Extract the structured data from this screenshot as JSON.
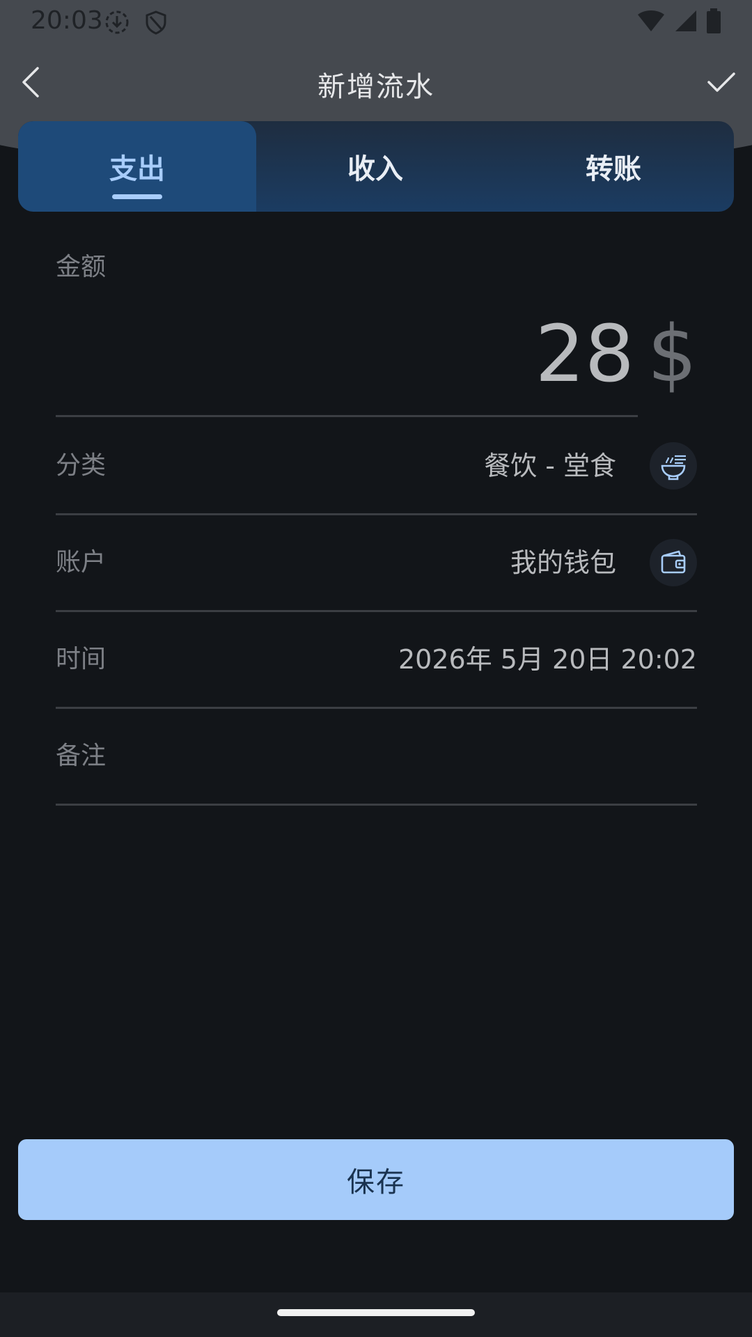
{
  "status_bar": {
    "time": "20:03",
    "icons": [
      "download-circle-icon",
      "shield-icon",
      "wifi-icon",
      "cellular-signal-icon",
      "battery-icon"
    ]
  },
  "app_bar": {
    "title": "新增流水",
    "back_icon": "chevron-left-icon",
    "confirm_icon": "checkmark-icon"
  },
  "tabs": [
    {
      "label": "支出",
      "active": true
    },
    {
      "label": "收入",
      "active": false
    },
    {
      "label": "转账",
      "active": false
    }
  ],
  "form": {
    "amount": {
      "label": "金额",
      "value": "28",
      "currency": "$"
    },
    "category": {
      "label": "分类",
      "value": "餐饮 - 堂食",
      "icon": "noodle-bowl-icon"
    },
    "account": {
      "label": "账户",
      "value": "我的钱包",
      "icon": "wallet-icon"
    },
    "time": {
      "label": "时间",
      "value": "2026年 5月 20日 20:02"
    },
    "note": {
      "label": "备注",
      "value": ""
    }
  },
  "save_button": {
    "label": "保存"
  },
  "colors": {
    "background": "#121519",
    "header": "#45494f",
    "tab_active": "#1e4a79",
    "accent": "#a8cdfb",
    "save_button": "#a5cbfa"
  }
}
